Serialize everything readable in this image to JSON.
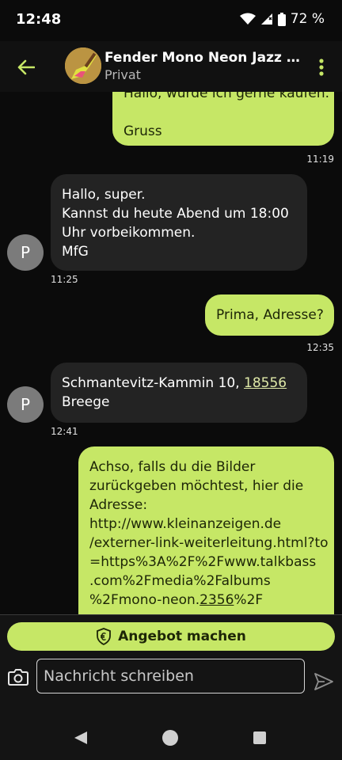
{
  "status": {
    "time": "12:48",
    "battery": "72 %"
  },
  "header": {
    "title": "Fender Mono Neon Jazz Bass",
    "subtitle": "Privat"
  },
  "messages": [
    {
      "dir": "out",
      "lines": [
        "Hallo, würde ich gerne kaufen.",
        "",
        "Gruss"
      ],
      "time": "11:19"
    },
    {
      "dir": "in",
      "lines": [
        "Hallo, super.",
        "Kannst du heute Abend um 18:00",
        "Uhr vorbeikommen.",
        "MfG"
      ],
      "time": "11:25",
      "avatar": "P"
    },
    {
      "dir": "out",
      "lines": [
        "Prima, Adresse?"
      ],
      "time": "12:35"
    },
    {
      "dir": "in",
      "address_pre": "Schmantevitz-Kammin 10, ",
      "address_zip": "18556",
      "address_city": "Breege",
      "time": "12:41",
      "avatar": "P"
    },
    {
      "dir": "out",
      "lines": [
        "Achso, falls du die Bilder",
        "zurückgeben möchtest, hier die",
        "Adresse:",
        "http://www.kleinanzeigen.de",
        "/externer-link-weiterleitung.html?to",
        "=https%3A%2F%2Fwww.talkbass",
        ".com%2Fmedia%2Falbums"
      ],
      "last_pre": "%2Fmono-neon.",
      "last_link": "2356",
      "last_post": "%2F"
    }
  ],
  "composer": {
    "offer_label": "Angebot machen",
    "placeholder": "Nachricht schreiben"
  },
  "colors": {
    "accent": "#c6e766",
    "background": "#0b0b0b",
    "incoming": "#232323"
  }
}
